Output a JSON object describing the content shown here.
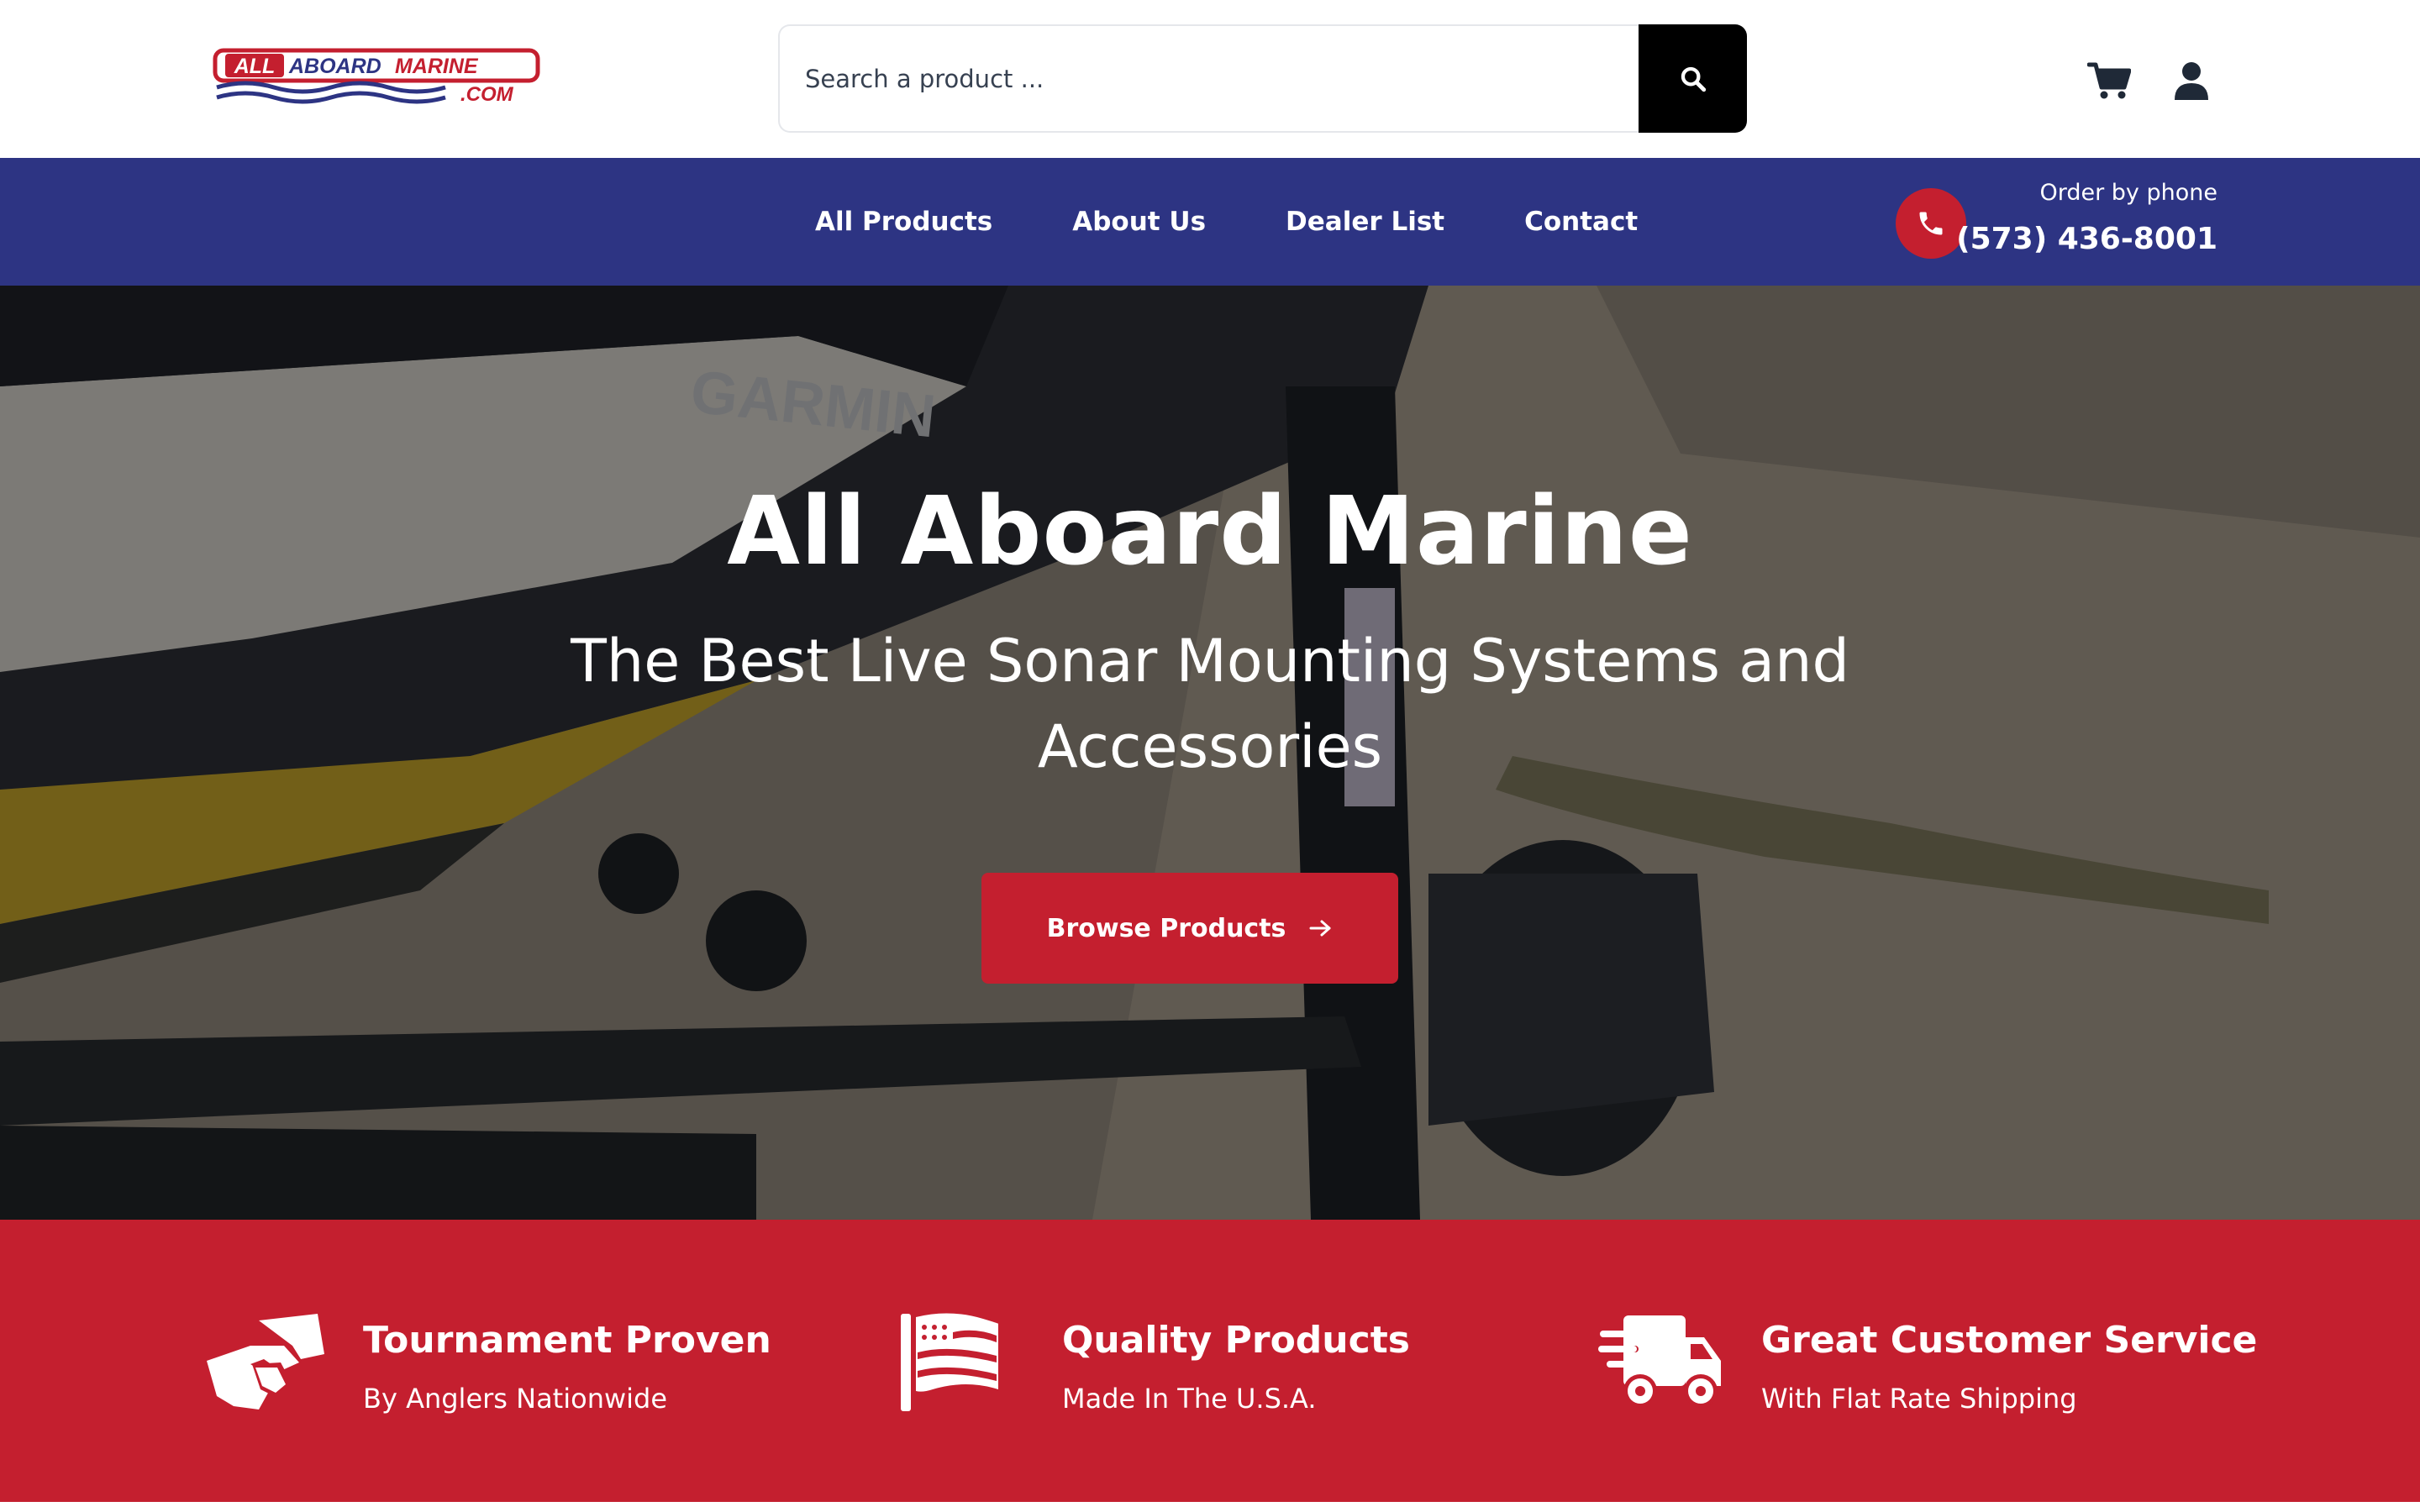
{
  "header": {
    "logo": {
      "text_main": "ALL ABOARD MARINE",
      "text_sub": ".COM"
    },
    "search": {
      "placeholder": "Search a product ...",
      "value": ""
    },
    "icons": {
      "search": "search-icon",
      "cart": "cart-icon",
      "account": "user-icon"
    }
  },
  "nav": {
    "items": [
      {
        "label": "All Products"
      },
      {
        "label": "About Us"
      },
      {
        "label": "Dealer List"
      },
      {
        "label": "Contact"
      }
    ],
    "phone": {
      "caption": "Order by phone",
      "number": "(573) 436-8001",
      "icon": "phone-icon"
    }
  },
  "hero": {
    "title": "All Aboard Marine",
    "subtitle": "The Best Live Sonar Mounting Systems and Accessories",
    "cta_label": "Browse Products",
    "cta_icon": "arrow-right-icon"
  },
  "features": [
    {
      "title": "Tournament Proven",
      "subtitle": "By Anglers Nationwide",
      "icon": "handshake-icon"
    },
    {
      "title": "Quality Products",
      "subtitle": "Made In The U.S.A.",
      "icon": "flag-icon"
    },
    {
      "title": "Great Customer Service",
      "subtitle": "With Flat Rate Shipping",
      "icon": "truck-icon"
    }
  ],
  "colors": {
    "nav_blue": "#2d3483",
    "brand_red": "#c41f2f",
    "search_button": "#000000",
    "icon_dark": "#1f2937"
  }
}
